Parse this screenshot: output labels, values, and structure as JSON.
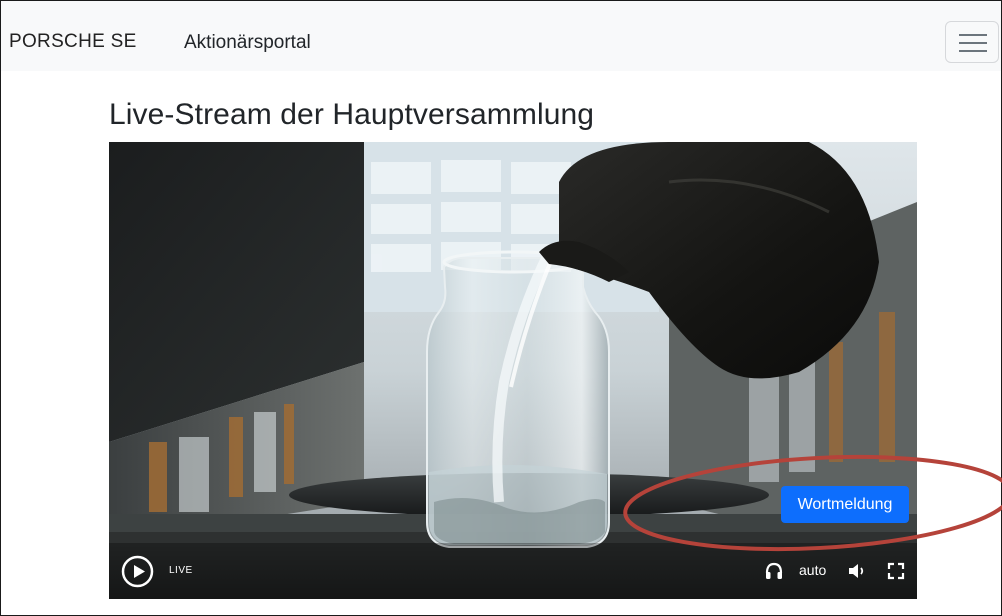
{
  "navbar": {
    "brand_logo": "PORSCHE SE",
    "brand_name": "Aktionärsportal",
    "menu_icon": "hamburger-icon"
  },
  "main": {
    "title": "Live-Stream der Hauptversammlung"
  },
  "video": {
    "request_button_label": "Wortmeldung",
    "controls": {
      "play_icon": "play-circle-icon",
      "live_label": "LIVE",
      "audio_icon": "headphones-icon",
      "quality_value": "auto",
      "volume_icon": "volume-icon",
      "fullscreen_icon": "fullscreen-icon"
    }
  },
  "colors": {
    "navbar_bg": "#f8f9fa",
    "primary_button": "#0d6efd",
    "annotation": "#b5433a"
  }
}
